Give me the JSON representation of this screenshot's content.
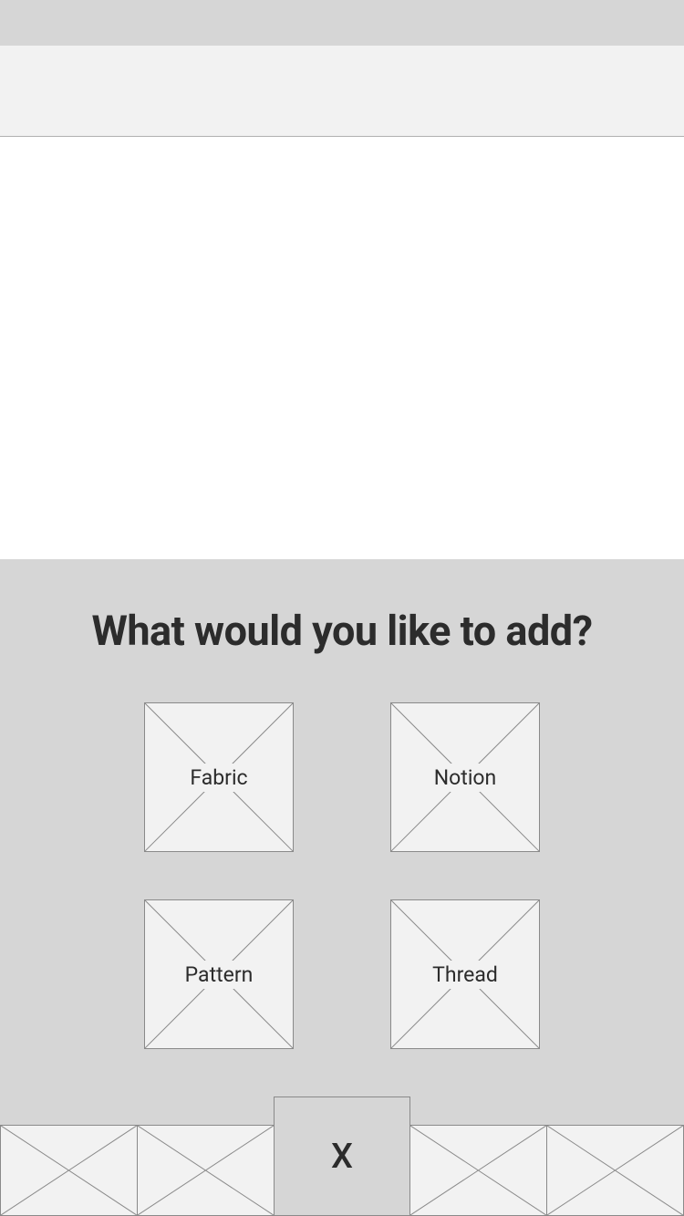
{
  "modal": {
    "title": "What would you like to add?",
    "options": [
      {
        "label": "Fabric"
      },
      {
        "label": "Notion"
      },
      {
        "label": "Pattern"
      },
      {
        "label": "Thread"
      }
    ],
    "close_label": "X"
  }
}
